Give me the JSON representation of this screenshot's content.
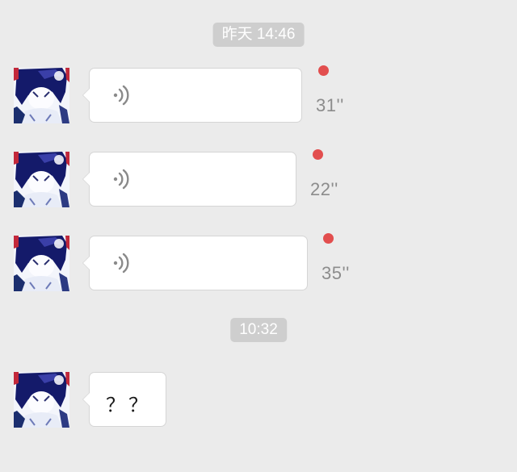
{
  "timestamps": [
    "昨天 14:46",
    "10:32"
  ],
  "messages": [
    {
      "type": "voice",
      "duration": "31''",
      "unread": true
    },
    {
      "type": "voice",
      "duration": "22''",
      "unread": true
    },
    {
      "type": "voice",
      "duration": "35''",
      "unread": true
    },
    {
      "type": "text",
      "text": "？？"
    }
  ],
  "colors": {
    "background": "#ebebeb",
    "bubble": "#ffffff",
    "unread_dot": "#e24e4e",
    "timestamp_pill": "#cecece",
    "duration_text": "#8c8c8c"
  },
  "icons": [
    "avatar",
    "voice-wave-icon",
    "unread-dot"
  ]
}
